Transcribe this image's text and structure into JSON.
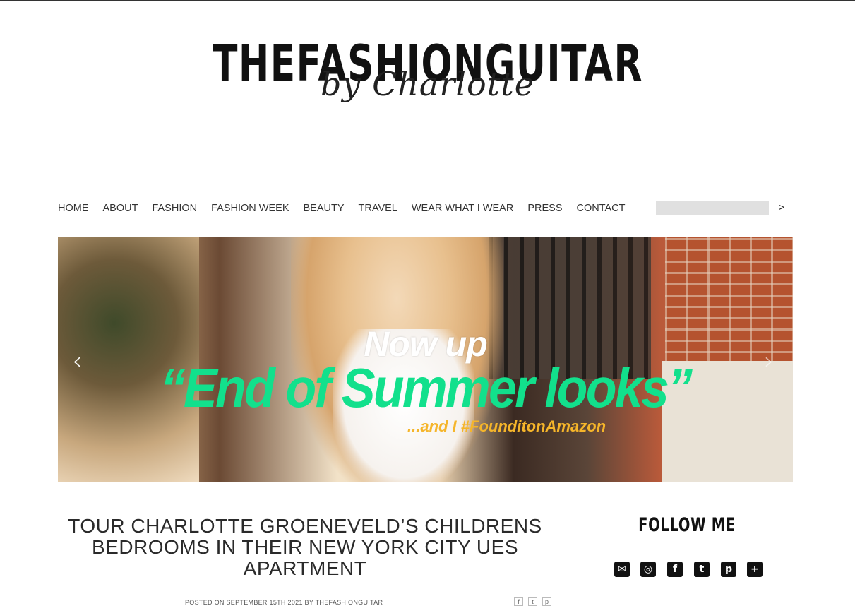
{
  "site": {
    "logo_main": "THEFASHIONGUITAR",
    "logo_sub": "by Charlotte"
  },
  "nav": {
    "items": [
      {
        "label": "HOME"
      },
      {
        "label": "ABOUT"
      },
      {
        "label": "FASHION"
      },
      {
        "label": "FASHION WEEK"
      },
      {
        "label": "BEAUTY"
      },
      {
        "label": "TRAVEL"
      },
      {
        "label": "WEAR WHAT I WEAR"
      },
      {
        "label": "PRESS"
      },
      {
        "label": "CONTACT"
      }
    ],
    "search_placeholder": "",
    "search_go": ">"
  },
  "hero": {
    "line1": "Now up",
    "line2": "“End of Summer looks”",
    "line3": "...and I #FounditonAmazon",
    "prev": "‹",
    "next": "›",
    "accent_green": "#12e08c",
    "accent_orange": "#f5b52a"
  },
  "post": {
    "title": "TOUR CHARLOTTE GROENEVELD’S CHILDRENS BEDROOMS IN THEIR NEW YORK CITY UES APARTMENT",
    "meta": "POSTED ON SEPTEMBER 15TH 2021 BY THEFASHIONGUITAR",
    "share": [
      {
        "icon": "facebook-icon",
        "glyph": "f"
      },
      {
        "icon": "tumblr-icon",
        "glyph": "t"
      },
      {
        "icon": "pinterest-icon",
        "glyph": "p"
      }
    ]
  },
  "sidebar": {
    "follow_title": "FOLLOW ME",
    "social": [
      {
        "icon": "email-icon",
        "glyph": "✉"
      },
      {
        "icon": "instagram-icon",
        "glyph": "◎"
      },
      {
        "icon": "facebook-icon",
        "glyph": "f"
      },
      {
        "icon": "twitter-icon",
        "glyph": "t"
      },
      {
        "icon": "pinterest-icon",
        "glyph": "p"
      },
      {
        "icon": "plus-icon",
        "glyph": "+"
      }
    ]
  }
}
